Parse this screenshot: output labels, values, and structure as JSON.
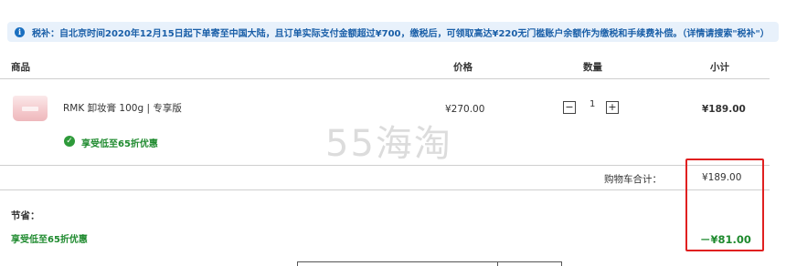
{
  "notice": {
    "icon": "info-icon",
    "text": "税补：自北京时间2020年12月15日起下单寄至中国大陆，且订单实际支付金额超过¥700，缴税后，可领取高达¥220无门槛账户余额作为缴税和手续费补偿。（详情请搜索\"税补\"）"
  },
  "table": {
    "headers": {
      "product": "商品",
      "price": "价格",
      "quantity": "数量",
      "subtotal": "小计"
    },
    "item": {
      "name": "RMK 卸妆膏 100g | 专享版",
      "price": "¥270.00",
      "quantity": "1",
      "subtotal": "¥189.00",
      "promo": "享受低至65折优惠"
    }
  },
  "totals": {
    "cart_total_label": "购物车合计：",
    "cart_total_value": "¥189.00",
    "savings_label": "节省：",
    "savings_promo": "享受低至65折优惠",
    "savings_value": "－¥81.00"
  },
  "watermark": "55海淘",
  "colors": {
    "accent_green": "#1e8a2e",
    "notice_blue": "#1a5fa8",
    "highlight_red": "#e02020"
  }
}
